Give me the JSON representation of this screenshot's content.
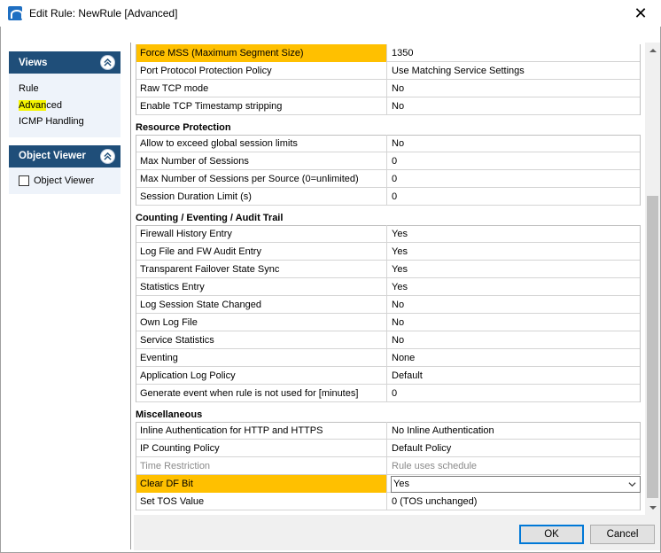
{
  "window": {
    "title": "Edit Rule: NewRule [Advanced]",
    "close_glyph": "✕"
  },
  "views_panel": {
    "title": "Views",
    "items": [
      {
        "label_hl": "",
        "label_rest": "Rule"
      },
      {
        "label_hl": "Advan",
        "label_rest": "ced"
      },
      {
        "label_hl": "",
        "label_rest": "ICMP Handling"
      }
    ]
  },
  "object_viewer_panel": {
    "title": "Object Viewer",
    "checkbox_label": "Object Viewer",
    "checked": false
  },
  "table": {
    "top_rows": [
      {
        "key": "Force MSS (Maximum Segment Size)",
        "value": "1350"
      },
      {
        "key": "Port Protocol Protection Policy",
        "value": "Use Matching Service Settings"
      },
      {
        "key": "Raw TCP mode",
        "value": "No"
      },
      {
        "key": "Enable TCP Timestamp stripping",
        "value": "No"
      }
    ],
    "resource": {
      "title": "Resource Protection",
      "rows": [
        {
          "key": "Allow to exceed global session limits",
          "value": "No"
        },
        {
          "key": "Max Number of Sessions",
          "value": "0"
        },
        {
          "key": "Max Number of Sessions per Source (0=unlimited)",
          "value": "0"
        },
        {
          "key": "Session Duration Limit (s)",
          "value": "0"
        }
      ]
    },
    "counting": {
      "title": "Counting / Eventing / Audit Trail",
      "rows": [
        {
          "key": "Firewall History Entry",
          "value": "Yes"
        },
        {
          "key": "Log File and FW Audit Entry",
          "value": "Yes"
        },
        {
          "key": "Transparent Failover State Sync",
          "value": "Yes"
        },
        {
          "key": "Statistics Entry",
          "value": "Yes"
        },
        {
          "key": "Log Session State Changed",
          "value": "No"
        },
        {
          "key": "Own Log File",
          "value": "No"
        },
        {
          "key": "Service Statistics",
          "value": "No"
        },
        {
          "key": "Eventing",
          "value": "None"
        },
        {
          "key": "Application Log Policy",
          "value": "Default"
        },
        {
          "key": "Generate event when rule is not used for [minutes]",
          "value": "0"
        }
      ]
    },
    "misc": {
      "title": "Miscellaneous",
      "rows": [
        {
          "key": "Inline Authentication for HTTP and HTTPS",
          "value": "No Inline Authentication"
        },
        {
          "key": "IP Counting Policy",
          "value": "Default Policy"
        },
        {
          "key": "Time Restriction",
          "value": "Rule uses schedule"
        },
        {
          "key": "Clear DF Bit",
          "value": "Yes"
        },
        {
          "key": "Set TOS Value",
          "value": "0 (TOS unchanged)"
        }
      ]
    }
  },
  "buttons": {
    "ok": "OK",
    "cancel": "Cancel"
  },
  "colors": {
    "highlight_orange": "#ffc000",
    "panel_header": "#1f4e79",
    "panel_body": "#eef3fa",
    "text_highlight_yellow": "#f5f500"
  }
}
